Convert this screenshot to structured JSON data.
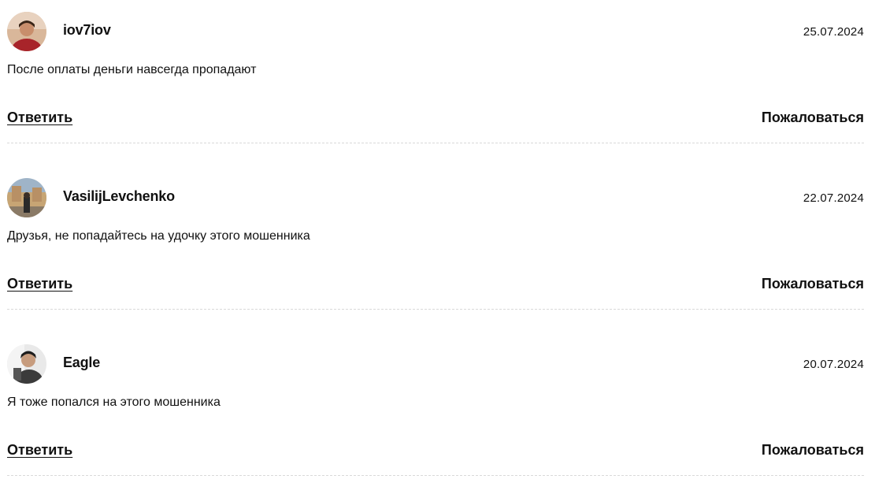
{
  "comments": [
    {
      "username": "iov7iov",
      "date": "25.07.2024",
      "text": "После оплаты деньги навсегда пропадают",
      "reply_label": "Ответить",
      "report_label": "Пожаловаться"
    },
    {
      "username": "VasilijLevchenko",
      "date": "22.07.2024",
      "text": "Друзья, не попадайтесь на удочку этого мошенника",
      "reply_label": "Ответить",
      "report_label": "Пожаловаться"
    },
    {
      "username": "Eagle",
      "date": "20.07.2024",
      "text": "Я тоже попался на этого мошенника",
      "reply_label": "Ответить",
      "report_label": "Пожаловаться"
    }
  ]
}
